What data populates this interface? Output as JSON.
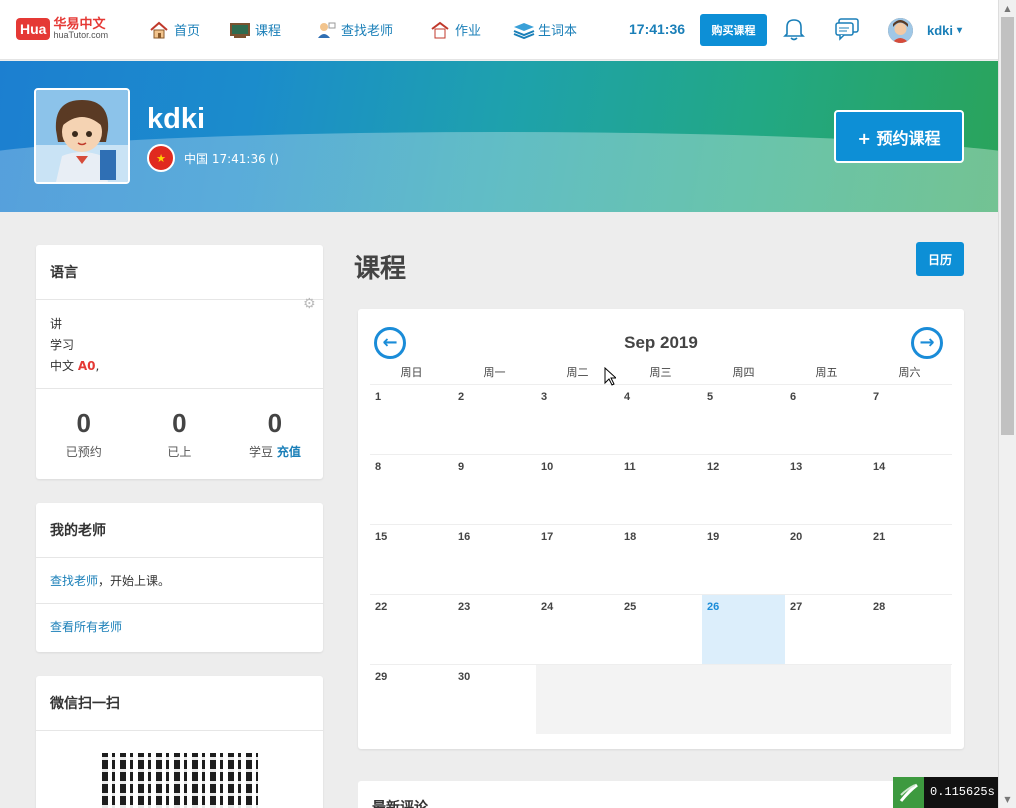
{
  "nav": {
    "logo_badge": "Hua",
    "logo_cn": "华易中文",
    "logo_en": "huaTutor.com",
    "items": [
      {
        "label": "首页",
        "icon": "home-icon"
      },
      {
        "label": "课程",
        "icon": "blackboard-icon"
      },
      {
        "label": "查找老师",
        "icon": "teacher-icon"
      },
      {
        "label": "作业",
        "icon": "homework-icon"
      },
      {
        "label": "生词本",
        "icon": "books-icon"
      }
    ],
    "clock": "17:41:36",
    "buy_label": "购买课程",
    "username": "kdki",
    "caret": "▾"
  },
  "banner": {
    "name": "kdki",
    "location": "中国 17:41:36 ()",
    "book_label": "+ 预约课程"
  },
  "language_card": {
    "title": "语言",
    "speaks_label": "讲",
    "learns_label": "学习",
    "language": "中文",
    "level": "A0",
    "trailing": ",",
    "stats": [
      {
        "num": "0",
        "label": "已预约"
      },
      {
        "num": "0",
        "label": "已上"
      },
      {
        "num": "0",
        "label": "学豆",
        "link": "充值"
      }
    ]
  },
  "teacher_card": {
    "title": "我的老师",
    "find_link": "查找老师",
    "find_suffix": "，开始上课。",
    "all_link": "查看所有老师"
  },
  "wechat_card": {
    "title": "微信扫一扫"
  },
  "main": {
    "title": "课程",
    "calendar_button": "日历",
    "review_title": "最新评论"
  },
  "calendar": {
    "month": "Sep 2019",
    "weekdays": [
      "周日",
      "周一",
      "周二",
      "周三",
      "周四",
      "周五",
      "周六"
    ],
    "weeks": [
      [
        "1",
        "2",
        "3",
        "4",
        "5",
        "6",
        "7"
      ],
      [
        "8",
        "9",
        "10",
        "11",
        "12",
        "13",
        "14"
      ],
      [
        "15",
        "16",
        "17",
        "18",
        "19",
        "20",
        "21"
      ],
      [
        "22",
        "23",
        "24",
        "25",
        "26",
        "27",
        "28"
      ],
      [
        "29",
        "30",
        "",
        "",
        "",
        "",
        ""
      ]
    ],
    "today": "26"
  },
  "timer": "0.115625s"
}
